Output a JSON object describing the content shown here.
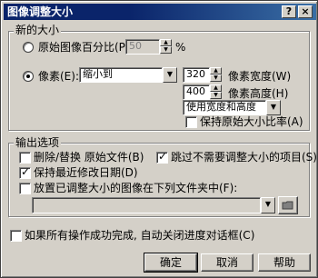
{
  "window": {
    "title": "图像调整大小",
    "help_button": "?",
    "close_button": "×"
  },
  "size_group": {
    "label": "新的大小",
    "percent_option": {
      "label": "原始图像百分比(P):",
      "value": "50",
      "unit": "%",
      "selected": false
    },
    "pixel_option": {
      "label": "像素(E):",
      "selected": true
    },
    "pixel_mode": {
      "value": "缩小到"
    },
    "width": {
      "value": "320",
      "label": "像素宽度(W)"
    },
    "height": {
      "value": "400",
      "label": "像素高度(H)"
    },
    "constraint": {
      "value": "使用宽度和高度"
    },
    "keep_ratio": {
      "label": "保持原始大小比率(A)",
      "checked": false
    }
  },
  "output_group": {
    "label": "输出选项",
    "delete_replace": {
      "label": "删除/替换 原始文件(B)",
      "checked": false
    },
    "skip_unneeded": {
      "label": "跳过不需要调整大小的项目(S)",
      "checked": true
    },
    "keep_date": {
      "label": "保持最近修改日期(D)",
      "checked": true
    },
    "put_in_folder": {
      "label": "放置已调整大小的图像在下列文件夹中(F):",
      "checked": false
    },
    "folder_path": {
      "value": ""
    }
  },
  "auto_close": {
    "label": "如果所有操作成功完成, 自动关闭进度对话框(C)",
    "checked": false
  },
  "buttons": {
    "ok": "确定",
    "cancel": "取消",
    "help": "帮助"
  },
  "icons": {
    "browse": "folder-browse-icon"
  }
}
